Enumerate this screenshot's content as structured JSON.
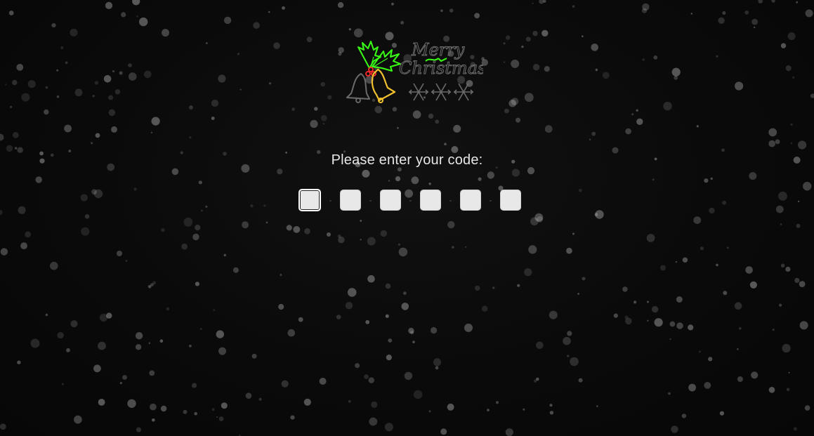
{
  "logo": {
    "text_line1": "Merry",
    "text_line2": "Christmas",
    "icons": [
      "holly-icon",
      "bells-icon",
      "snowflake-icon"
    ]
  },
  "code_form": {
    "prompt": "Please enter your code:",
    "digits": [
      {
        "value": "",
        "placeholder": ""
      },
      {
        "value": "",
        "placeholder": ""
      },
      {
        "value": "",
        "placeholder": ""
      },
      {
        "value": "",
        "placeholder": ""
      },
      {
        "value": "",
        "placeholder": ""
      },
      {
        "value": "",
        "placeholder": ""
      }
    ],
    "separator": "-"
  },
  "colors": {
    "background": "#0a0a0a",
    "prompt_text": "#e6e6e6",
    "input_fill": "#e8e8e8",
    "holly_green": "#39ff14",
    "bell_gold": "#f2c12e",
    "berry_red": "#ff2a2a",
    "neon_gray": "#6b6b6b"
  }
}
